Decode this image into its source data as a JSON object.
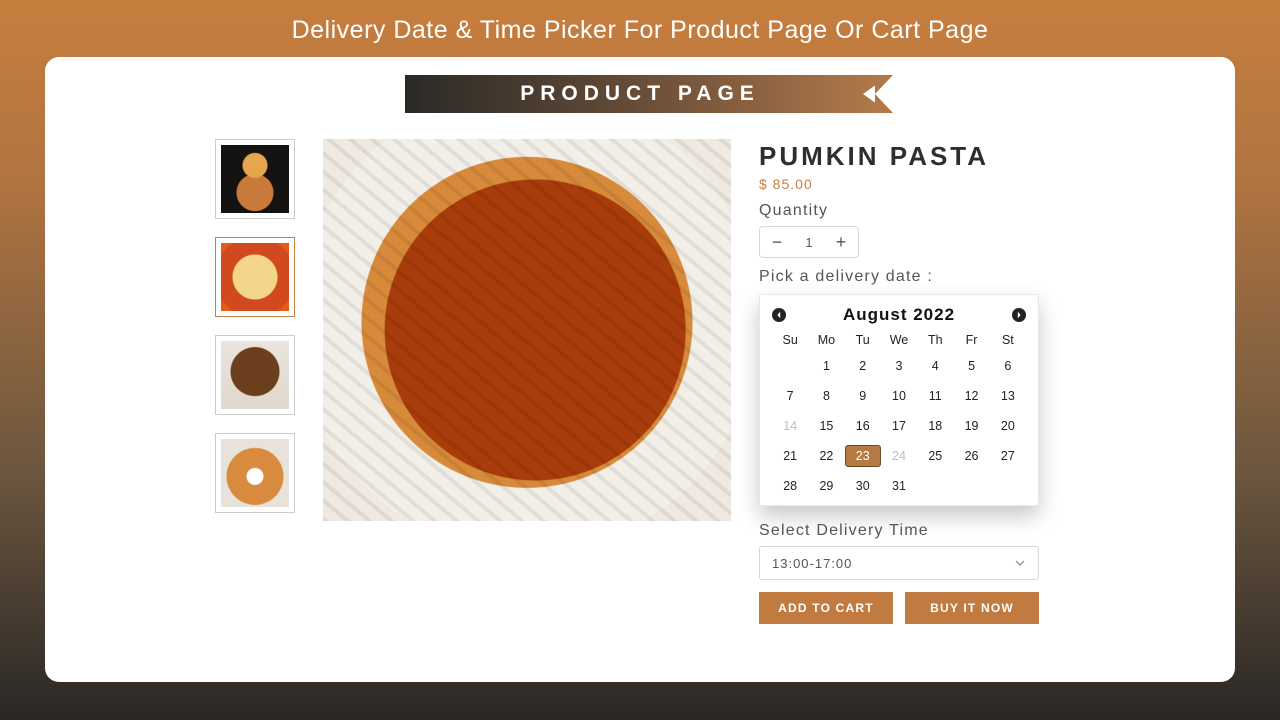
{
  "header": {
    "title": "Delivery Date & Time Picker For Product Page Or Cart Page"
  },
  "ribbon": {
    "label": "PRODUCT PAGE"
  },
  "product": {
    "title": "PUMKIN PASTA",
    "price": "$ 85.00",
    "qty_label": "Quantity",
    "qty_value": "1",
    "date_label": "Pick a delivery date :",
    "time_label": "Select Delivery Time",
    "time_value": "13:00-17:00",
    "add_to_cart": "ADD TO CART",
    "buy_now": "BUY IT NOW"
  },
  "calendar": {
    "month": "August 2022",
    "dow": [
      "Su",
      "Mo",
      "Tu",
      "We",
      "Th",
      "Fr",
      "St"
    ],
    "weeks": [
      [
        {
          "n": ""
        },
        {
          "n": "1"
        },
        {
          "n": "2"
        },
        {
          "n": "3"
        },
        {
          "n": "4"
        },
        {
          "n": "5"
        },
        {
          "n": "6"
        }
      ],
      [
        {
          "n": "7"
        },
        {
          "n": "8"
        },
        {
          "n": "9"
        },
        {
          "n": "10"
        },
        {
          "n": "11"
        },
        {
          "n": "12"
        },
        {
          "n": "13"
        }
      ],
      [
        {
          "n": "14",
          "dis": true
        },
        {
          "n": "15"
        },
        {
          "n": "16"
        },
        {
          "n": "17"
        },
        {
          "n": "18"
        },
        {
          "n": "19"
        },
        {
          "n": "20"
        }
      ],
      [
        {
          "n": "21"
        },
        {
          "n": "22"
        },
        {
          "n": "23",
          "sel": true
        },
        {
          "n": "24",
          "dis": true
        },
        {
          "n": "25"
        },
        {
          "n": "26"
        },
        {
          "n": "27"
        }
      ],
      [
        {
          "n": "28"
        },
        {
          "n": "29"
        },
        {
          "n": "30"
        },
        {
          "n": "31"
        },
        {
          "n": ""
        },
        {
          "n": ""
        },
        {
          "n": ""
        }
      ]
    ]
  },
  "thumbs": [
    "pasta-fork",
    "pizza",
    "chocolate-cake",
    "soup-bowl"
  ]
}
